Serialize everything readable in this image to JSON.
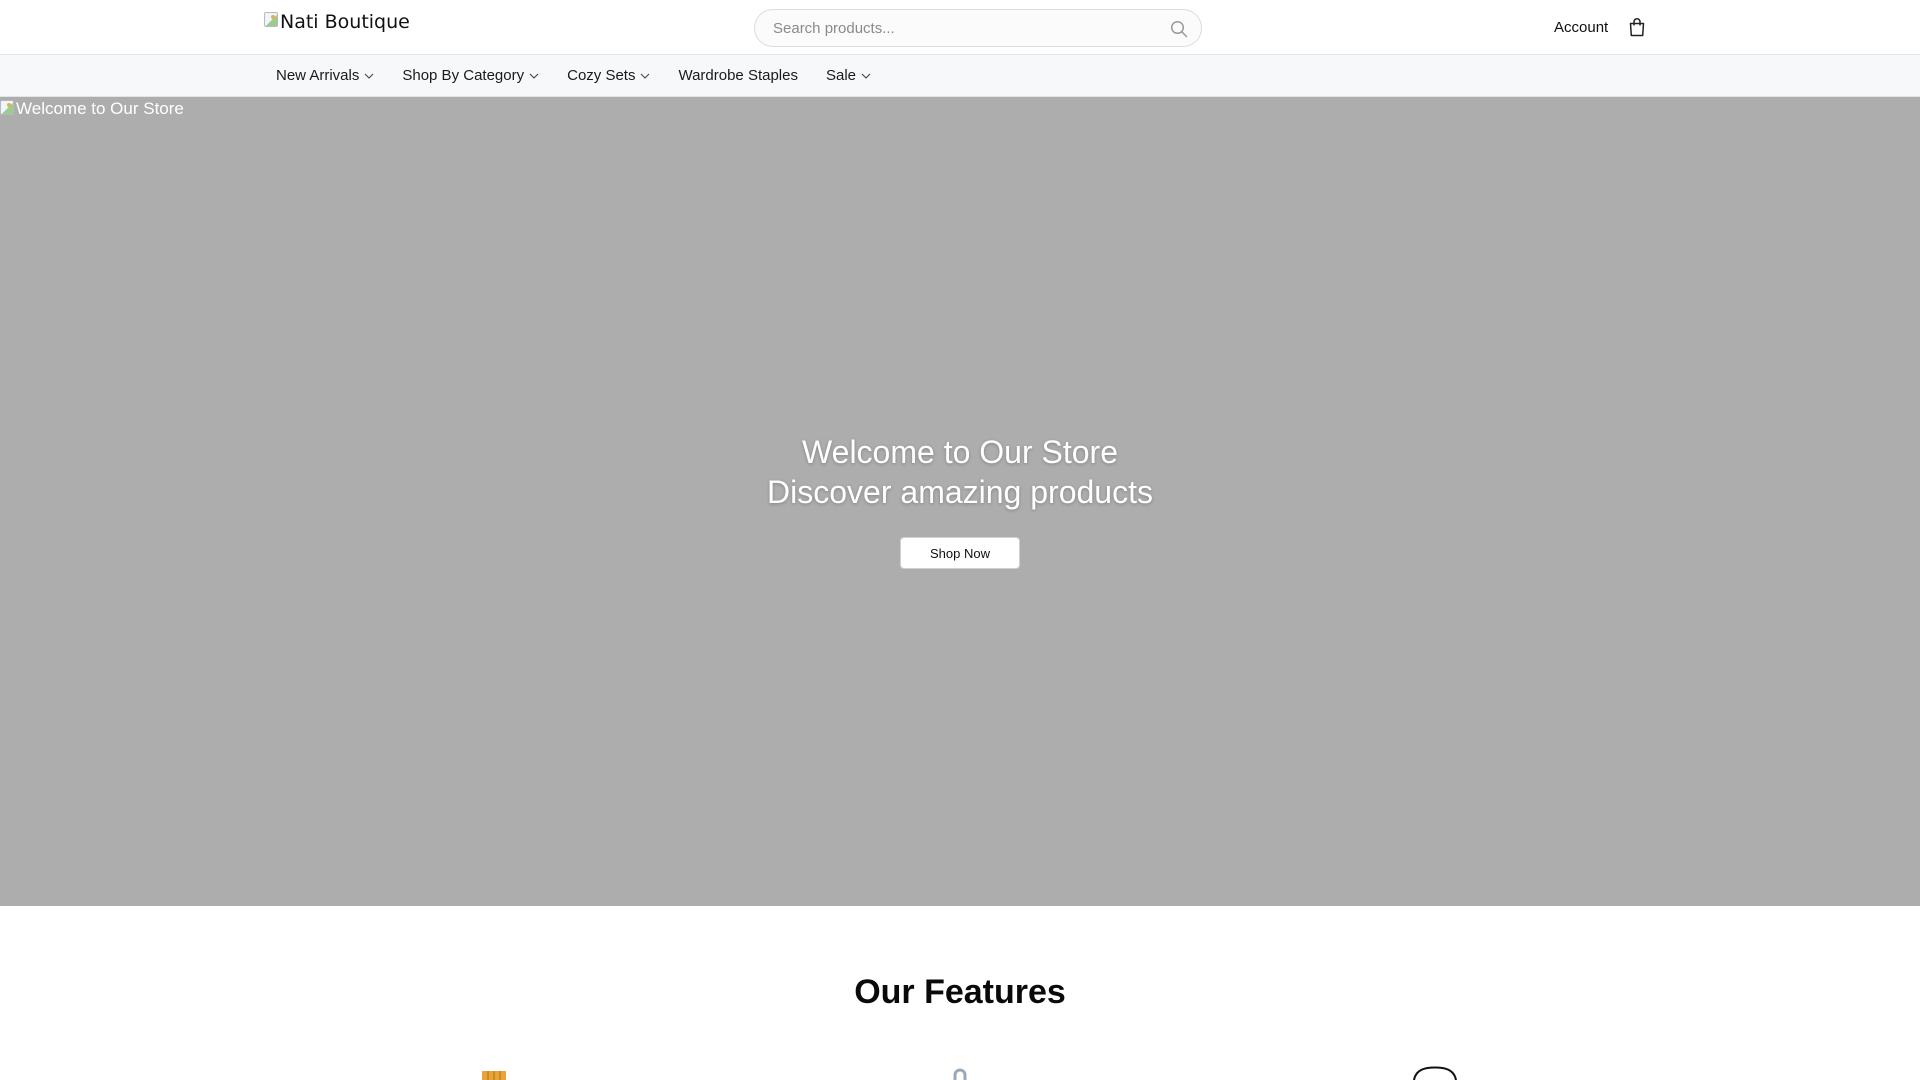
{
  "header": {
    "logo_alt": "Nati Boutique",
    "search_placeholder": "Search products...",
    "search_value": "",
    "account_label": "Account",
    "icons": {
      "search": "search-icon",
      "cart": "shopping-bag-icon"
    }
  },
  "nav": {
    "items": [
      {
        "label": "New Arrivals",
        "has_dropdown": true
      },
      {
        "label": "Shop By Category",
        "has_dropdown": true
      },
      {
        "label": "Cozy Sets",
        "has_dropdown": true
      },
      {
        "label": "Wardrobe Staples",
        "has_dropdown": false
      },
      {
        "label": "Sale",
        "has_dropdown": true
      }
    ]
  },
  "hero": {
    "image_alt": "Welcome to Our Store",
    "title": "Welcome to Our Store",
    "subtitle": "Discover amazing products",
    "cta_label": "Shop Now",
    "background_color": "#adadad"
  },
  "features": {
    "title": "Our Features",
    "icons": [
      "shipping-box-icon",
      "lock-icon",
      "chat-bubble-icon"
    ]
  }
}
